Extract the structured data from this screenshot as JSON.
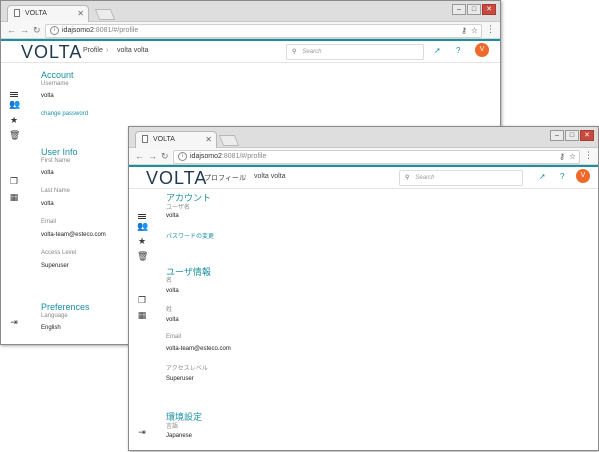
{
  "windows": [
    {
      "tab_title": "VOLTA",
      "url_host": "idajsomo2",
      "url_rest": ":8081/#/profile",
      "logo": "VOLTA",
      "breadcrumb": [
        "Profile",
        "volta volta"
      ],
      "breadcrumb_sep": "›",
      "search_placeholder": "Search",
      "avatar": "V",
      "sections": {
        "account": "Account",
        "username_label": "Username",
        "username": "volta",
        "change_password": "change password",
        "user_info": "User Info",
        "first_name_label": "First Name",
        "first_name": "volta",
        "last_name_label": "Last Name",
        "last_name": "volta",
        "email_label": "Email",
        "email": "volta-team@esteco.com",
        "access_label": "Access Level",
        "access": "Superuser",
        "preferences": "Preferences",
        "language_label": "Language",
        "language": "English"
      }
    },
    {
      "tab_title": "VOLTA",
      "url_host": "idajsomo2",
      "url_rest": ":8081/#/profile",
      "logo": "VOLTA",
      "breadcrumb": [
        "プロフィール",
        "volta volta"
      ],
      "breadcrumb_sep": "›",
      "search_placeholder": "Search",
      "avatar": "V",
      "sections": {
        "account": "アカウント",
        "username_label": "ユーザ名",
        "username": "volta",
        "change_password": "パスワードの変更",
        "user_info": "ユーザ情報",
        "first_name_label": "名",
        "first_name": "volta",
        "last_name_label": "姓",
        "last_name": "volta",
        "email_label": "Email",
        "email": "volta-team@esteco.com",
        "access_label": "アクセスレベル",
        "access": "Superuser",
        "preferences": "環境設定",
        "language_label": "言語",
        "language": "Japanese"
      }
    }
  ],
  "colors": {
    "accent": "#1a8fa2",
    "avatar": "#ee6a2a",
    "logo": "#1f3a4f"
  },
  "icons": [
    "menu-icon",
    "users-icon",
    "star-icon",
    "trash-icon",
    "library-icon",
    "grid-icon",
    "collapse-icon",
    "rocket-icon",
    "help-icon",
    "search-icon",
    "key-icon",
    "bookmark-star-icon",
    "kebab-menu-icon"
  ]
}
